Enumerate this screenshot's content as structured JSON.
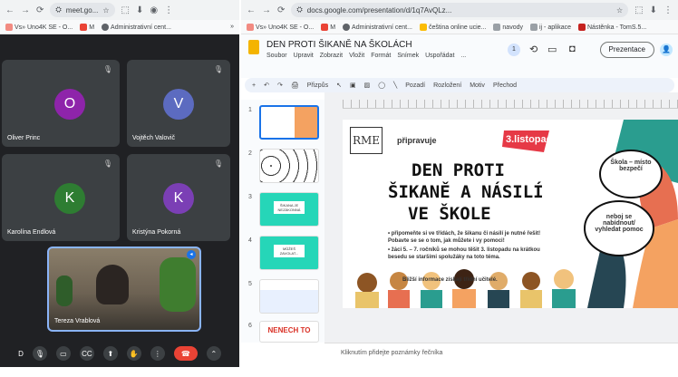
{
  "left_window": {
    "url": "meet.go...",
    "bookmarks": [
      "Vs» Uno4K SE - O...",
      "M",
      "Administrativní cent..."
    ]
  },
  "meet": {
    "participants": [
      {
        "name": "Oliver Princ",
        "initial": "O",
        "color": "#8e24aa"
      },
      {
        "name": "Vojtěch Valovič",
        "initial": "V",
        "color": "#5c6bc0"
      },
      {
        "name": "Karolína Endlová",
        "initial": "K",
        "color": "#2e7d32"
      },
      {
        "name": "Kristýna Pokorná",
        "initial": "K",
        "color": "#7b3fb5"
      }
    ],
    "self_name": "Tereza Vrablová",
    "controls": [
      "D",
      "mic",
      "cam",
      "CC",
      "share",
      "hand",
      "more",
      "end-call",
      "up"
    ]
  },
  "right_window": {
    "url": "docs.google.com/presentation/d/1q7AvQLz...",
    "bookmarks": [
      "Vs» Uno4K SE - O...",
      "M",
      "Administrativní cent...",
      "čeština online ucie...",
      "navody",
      "ij - aplikace",
      "Nástěnka - TomS.5..."
    ]
  },
  "docs": {
    "title": "DEN PROTI ŠIKANĚ NA ŠKOLÁCH",
    "menu": [
      "Soubor",
      "Upravit",
      "Zobrazit",
      "Vložit",
      "Formát",
      "Snímek",
      "Uspořádat",
      "..."
    ],
    "present_label": "Prezentace",
    "toolbar": [
      "+",
      "↶",
      "↷",
      "🖨",
      "Přizpůs",
      "Pozadí",
      "Rozložení",
      "Motiv",
      "Přechod"
    ],
    "slide_numbers": [
      "1",
      "2",
      "3",
      "4",
      "5",
      "6"
    ],
    "notes_placeholder": "Kliknutím přidejte poznámky řečníka"
  },
  "slide": {
    "logo": "RME",
    "pripravuje": "připravuje",
    "date": "3.listopadu",
    "heading_1": "DEN PROTI",
    "heading_2": "ŠIKANĚ A NÁSILÍ",
    "heading_3": "VE ŠKOLE",
    "bullets": [
      "připomeňte si ve třídách, že šikanu či násilí je nutné řešit! Pobavte se se o tom, jak můžete i vy pomoci!",
      "žáci 5. – 7. ročníků se mohou těšit 3. listopadu na krátkou besedu se staršími spolužáky na toto téma."
    ],
    "footer": "Bližší informace získají třídní učitelé.",
    "bubble_1": "Škola – místo bezpečí",
    "bubble_2": "neboj se nabídnout/ vyhledat pomoc"
  },
  "thumbs": {
    "t3": "ŠIKANA JE NEZÁKONNÁ",
    "t4": "MŮŽEŠ ZAVOLAT...",
    "t6": "NENECH TO"
  }
}
